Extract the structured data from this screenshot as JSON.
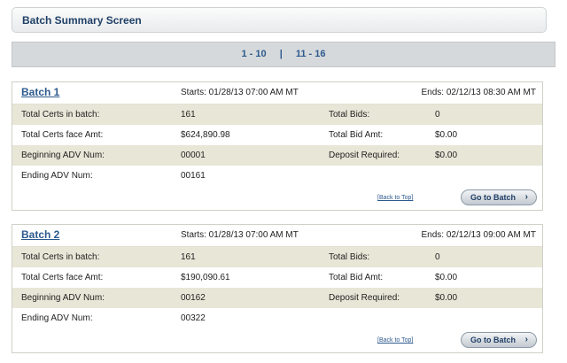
{
  "page_title": "Batch Summary Screen",
  "pager": {
    "page1": "1 - 10",
    "separator": "|",
    "page2": "11 - 16"
  },
  "labels": {
    "total_certs": "Total Certs in batch:",
    "total_face": "Total Certs face Amt:",
    "beginning_adv": "Beginning ADV Num:",
    "ending_adv": "Ending ADV Num:",
    "total_bids": "Total Bids:",
    "total_bid_amt": "Total Bid Amt:",
    "deposit_required": "Deposit Required:",
    "back_to_top": "[Back to Top]",
    "go_to_batch": "Go to Batch"
  },
  "batches": [
    {
      "title": "Batch 1",
      "starts": "Starts: 01/28/13 07:00 AM MT",
      "ends": "Ends: 02/12/13 08:30 AM MT",
      "total_certs": "161",
      "total_face": "$624,890.98",
      "beginning_adv": "00001",
      "ending_adv": "00161",
      "total_bids": "0",
      "total_bid_amt": "$0.00",
      "deposit_required": "$0.00"
    },
    {
      "title": "Batch 2",
      "starts": "Starts: 01/28/13 07:00 AM MT",
      "ends": "Ends: 02/12/13 09:00 AM MT",
      "total_certs": "161",
      "total_face": "$190,090.61",
      "beginning_adv": "00162",
      "ending_adv": "00322",
      "total_bids": "0",
      "total_bid_amt": "$0.00",
      "deposit_required": "$0.00"
    }
  ]
}
